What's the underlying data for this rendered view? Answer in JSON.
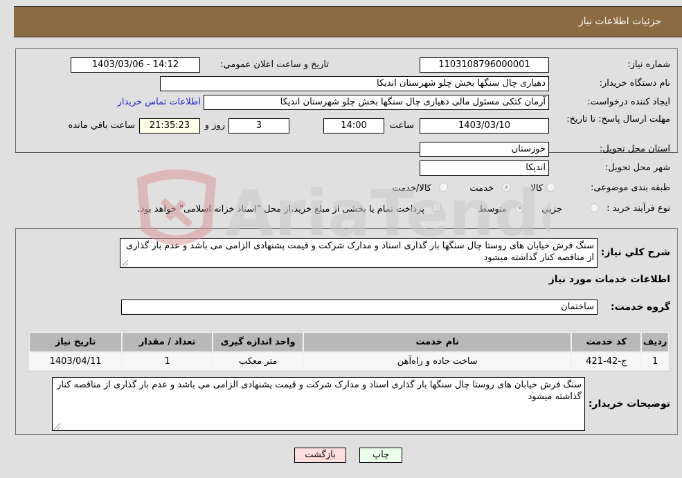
{
  "header": {
    "title": "جزئیات اطلاعات نیاز"
  },
  "info": {
    "need_number_label": "شماره نیاز:",
    "need_number": "1103108796000001",
    "announce_label": "تاريخ و ساعت اعلان عمومي:",
    "announce_value": "1403/03/06 - 14:12",
    "buyer_org_label": "نام دستگاه خريدار:",
    "buyer_org": "دهیاری چال سنگها بخش چلو شهرستان اندیکا",
    "creator_label": "ایجاد کننده درخواست:",
    "creator": "آرمان کتکی مسئول مالی   دهیاری چال سنگها بخش چلو شهرستان اندیکا",
    "contact_link": "اطلاعات تماس خريدار",
    "deadline_label": "مهلت ارسال پاسخ: تا تاریخ:",
    "deadline_date": "1403/03/10",
    "time_label": "ساعت",
    "deadline_time": "14:00",
    "days_value": "3",
    "days_label": "روز و",
    "remaining_time": "21:35:23",
    "remaining_label": "ساعت باقي مانده",
    "province_label": "استان محل تحویل:",
    "province": "خوزستان",
    "city_label": "شهر محل تحویل:",
    "city": "اندیکا",
    "category_label": "طبقه بندی موضوعی:",
    "category_options": [
      {
        "label": "کالا",
        "checked": false
      },
      {
        "label": "خدمت",
        "checked": true
      },
      {
        "label": "کالا/خدمت",
        "checked": false
      }
    ],
    "process_label": "نوع فرآیند خرید :",
    "process_options": [
      {
        "label": "جزيي",
        "checked": false
      },
      {
        "label": "متوسط",
        "checked": true
      }
    ],
    "treasury_note": "پرداخت تمام یا بخشی از مبلغ خرید،از محل \"اسناد خزانه اسلامی\" خواهد بود.",
    "treasury_checked": false
  },
  "details": {
    "general_desc_label": "شرح کلي نياز:",
    "general_desc": "سنگ فرش خیابان های  روستا چال سنگها بار گذاری اسناد و مدارک شرکت و قیمت پشنهادی الزامی می باشد و عدم بار گذاری از مناقصه کنار گذاشته میشود",
    "services_heading": "اطلاعات خدمات مورد نياز",
    "service_group_label": "گروه خدمت:",
    "service_group": "ساختمان",
    "table": {
      "headers": [
        "رديف",
        "کد خدمت",
        "نام خدمت",
        "واحد اندازه گيری",
        "تعداد / مقدار",
        "تاريخ نياز"
      ],
      "rows": [
        [
          "1",
          "ج-42-421",
          "ساخت جاده و راه‌آهن",
          "متر معکب",
          "1",
          "1403/04/11"
        ]
      ]
    },
    "buyer_notes_label": "توضيحات خريدار:",
    "buyer_notes": "سنگ فرش خیابان های  روستا چال سنگها بار گذاری اسناد و مدارک شرکت و قیمت پشنهادی الزامی می باشد و عدم بار گذاری از مناقصه کنار گذاشته میشود"
  },
  "buttons": {
    "print": "چاپ",
    "back": "بازگشت"
  },
  "watermark": {
    "text": "AriaTender.net"
  }
}
